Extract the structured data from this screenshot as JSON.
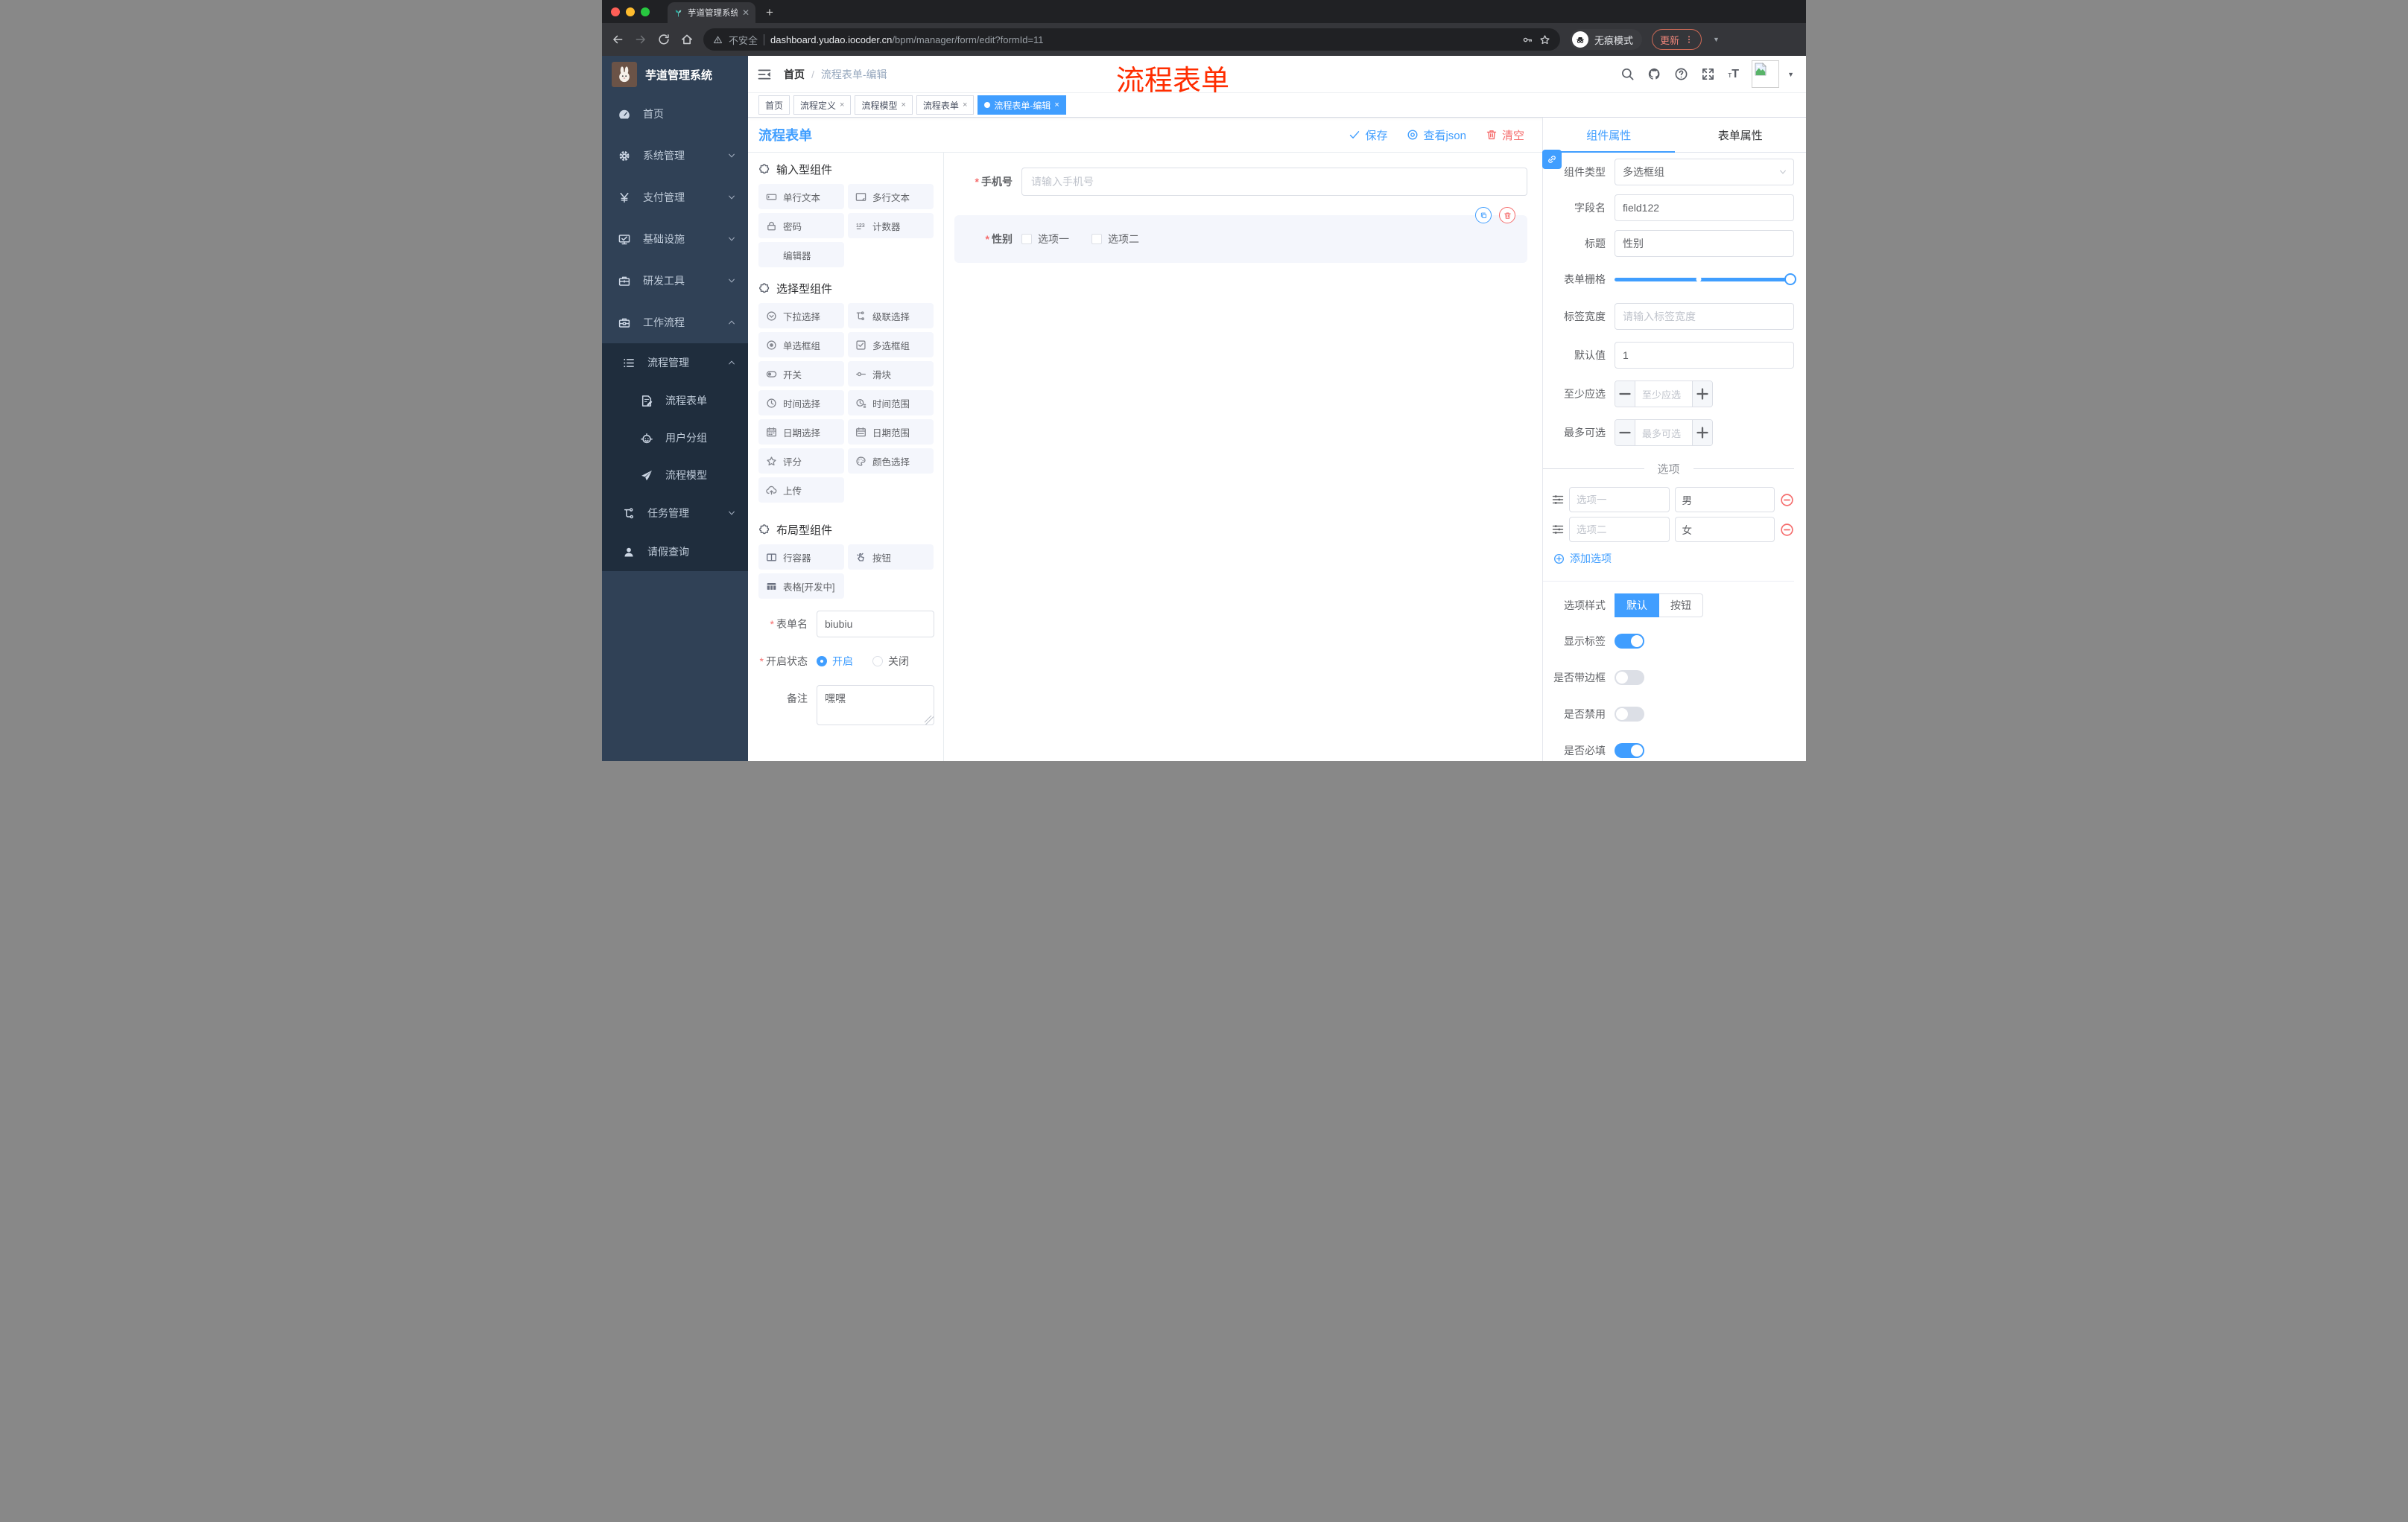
{
  "browser": {
    "tab_title": "芋道管理系统",
    "security_label": "不安全",
    "url_domain": "dashboard.yudao.iocoder.cn",
    "url_path": "/bpm/manager/form/edit?formId=11",
    "incognito_label": "无痕模式",
    "update_label": "更新"
  },
  "sidebar": {
    "logo_title": "芋道管理系统",
    "items": [
      {
        "label": "首页",
        "icon": "dashboard",
        "cls": "",
        "chev": ""
      },
      {
        "label": "系统管理",
        "icon": "gear",
        "cls": "",
        "chev": "chevdown"
      },
      {
        "label": "支付管理",
        "icon": "yen",
        "cls": "",
        "chev": "chevdown"
      },
      {
        "label": "基础设施",
        "icon": "monitor",
        "cls": "",
        "chev": "chevdown"
      },
      {
        "label": "研发工具",
        "icon": "toolbox",
        "cls": "",
        "chev": "chevdown"
      },
      {
        "label": "工作流程",
        "icon": "briefcase",
        "cls": "",
        "chev": "chevup"
      },
      {
        "label": "流程管理",
        "icon": "listtree",
        "cls": "sub",
        "chev": "chevup"
      },
      {
        "label": "流程表单",
        "icon": "formdoc",
        "cls": "leaf",
        "chev": ""
      },
      {
        "label": "用户分组",
        "icon": "robot",
        "cls": "leaf",
        "chev": ""
      },
      {
        "label": "流程模型",
        "icon": "send",
        "cls": "leaf",
        "chev": ""
      },
      {
        "label": "任务管理",
        "icon": "tree",
        "cls": "sub",
        "chev": "chevdown"
      },
      {
        "label": "请假查询",
        "icon": "user",
        "cls": "sub",
        "chev": ""
      }
    ]
  },
  "header": {
    "breadcrumb_home": "首页",
    "breadcrumb_current": "流程表单-编辑",
    "overlay_text": "流程表单"
  },
  "tags": {
    "items": [
      {
        "label": "首页",
        "cls": "",
        "closable": false,
        "active": false
      },
      {
        "label": "流程定义",
        "cls": "",
        "closable": true,
        "active": false
      },
      {
        "label": "流程模型",
        "cls": "",
        "closable": true,
        "active": false
      },
      {
        "label": "流程表单",
        "cls": "",
        "closable": true,
        "active": false
      },
      {
        "label": "流程表单-编辑",
        "cls": "active",
        "closable": true,
        "active": true
      }
    ]
  },
  "toolbar": {
    "title": "流程表单",
    "save_label": "保存",
    "view_json_label": "查看json",
    "clear_label": "清空"
  },
  "palette": {
    "section_input_title": "输入型组件",
    "input_items": [
      {
        "label": "单行文本",
        "icon": "ic-input"
      },
      {
        "label": "多行文本",
        "icon": "ic-textarea"
      },
      {
        "label": "密码",
        "icon": "ic-lock"
      },
      {
        "label": "计数器",
        "icon": "ic-counter"
      },
      {
        "label": "编辑器",
        "icon": ""
      }
    ],
    "section_select_title": "选择型组件",
    "select_items": [
      {
        "label": "下拉选择",
        "icon": "ic-select"
      },
      {
        "label": "级联选择",
        "icon": "ic-cascade"
      },
      {
        "label": "单选框组",
        "icon": "ic-radio"
      },
      {
        "label": "多选框组",
        "icon": "ic-checkbox"
      },
      {
        "label": "开关",
        "icon": "ic-switch"
      },
      {
        "label": "滑块",
        "icon": "ic-slider"
      },
      {
        "label": "时间选择",
        "icon": "ic-time"
      },
      {
        "label": "时间范围",
        "icon": "ic-timerange"
      },
      {
        "label": "日期选择",
        "icon": "ic-date"
      },
      {
        "label": "日期范围",
        "icon": "ic-daterange"
      },
      {
        "label": "评分",
        "icon": "ic-star"
      },
      {
        "label": "颜色选择",
        "icon": "ic-color"
      },
      {
        "label": "上传",
        "icon": "ic-upload"
      }
    ],
    "section_layout_title": "布局型组件",
    "layout_items": [
      {
        "label": "行容器",
        "icon": "ic-row"
      },
      {
        "label": "按钮",
        "icon": "ic-button"
      },
      {
        "label": "表格[开发中]",
        "icon": "ic-table"
      }
    ]
  },
  "form_meta": {
    "name_label": "表单名",
    "name_value": "biubiu",
    "status_label": "开启状态",
    "on_label": "开启",
    "off_label": "关闭",
    "remark_label": "备注",
    "remark_value": "嘿嘿"
  },
  "canvas": {
    "phone": {
      "label": "手机号",
      "placeholder": "请输入手机号"
    },
    "gender": {
      "label": "性别",
      "options": [
        {
          "label": "选项一"
        },
        {
          "label": "选项二"
        }
      ]
    }
  },
  "panel": {
    "tab_component": "组件属性",
    "tab_form": "表单属性",
    "rows": {
      "type_label": "组件类型",
      "type_value": "多选框组",
      "field_label": "字段名",
      "field_value": "field122",
      "title_label": "标题",
      "title_value": "性别",
      "grid_label": "表单栅格",
      "labelwidth_label": "标签宽度",
      "labelwidth_placeholder": "请输入标签宽度",
      "default_label": "默认值",
      "default_value": "1",
      "min_label": "至少应选",
      "min_placeholder": "至少应选",
      "max_label": "最多可选",
      "max_placeholder": "最多可选"
    },
    "options": {
      "title": "选项",
      "rows": [
        {
          "name": "选项一",
          "value": "男"
        },
        {
          "name": "选项二",
          "value": "女"
        }
      ],
      "add_label": "添加选项"
    },
    "style": {
      "label": "选项样式",
      "options": [
        {
          "label": "默认",
          "cls": "active"
        },
        {
          "label": "按钮",
          "cls": ""
        }
      ]
    },
    "toggles": [
      {
        "label": "显示标签",
        "cls": "on"
      },
      {
        "label": "是否带边框",
        "cls": ""
      },
      {
        "label": "是否禁用",
        "cls": ""
      },
      {
        "label": "是否必填",
        "cls": "on"
      }
    ]
  }
}
